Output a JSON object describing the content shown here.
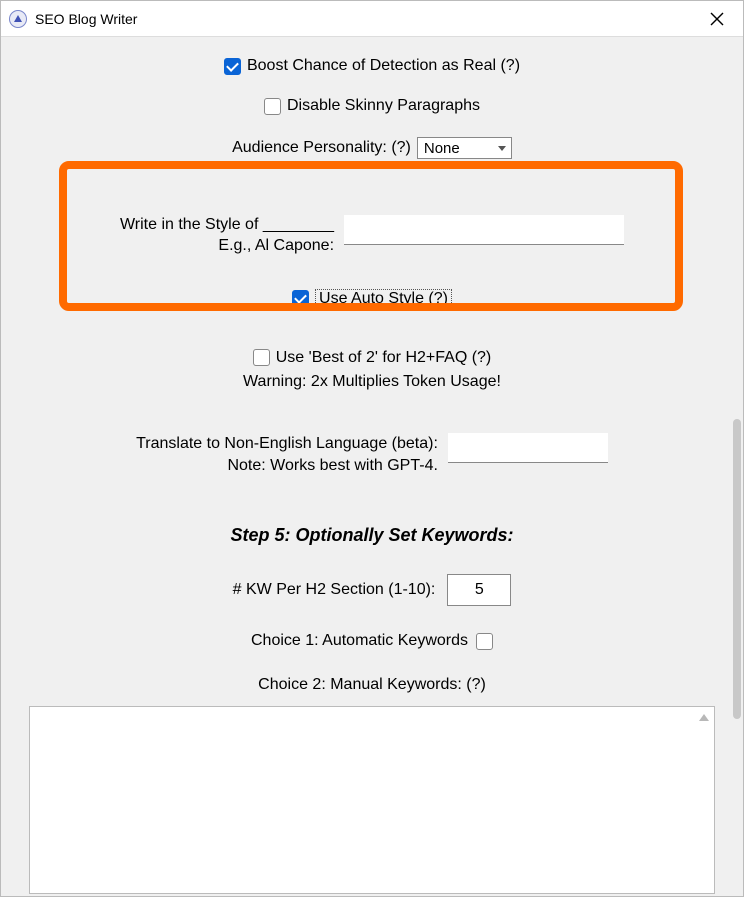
{
  "window": {
    "title": "SEO Blog Writer"
  },
  "boost_detection": {
    "label": "Boost Chance of Detection as Real (?)",
    "checked": true
  },
  "disable_skinny": {
    "label": "Disable Skinny Paragraphs",
    "checked": false
  },
  "audience": {
    "label": "Audience Personality: (?)",
    "selected": "None"
  },
  "style": {
    "label_line1": "Write in the Style of ________",
    "label_line2": "E.g., Al Capone:",
    "value": ""
  },
  "auto_style": {
    "label": "Use Auto Style (?)",
    "checked": true
  },
  "best_of_2": {
    "label": "Use 'Best of 2' for H2+FAQ (?)",
    "checked": false,
    "warning": "Warning: 2x Multiplies Token Usage!"
  },
  "translate": {
    "label_line1": "Translate to Non-English Language (beta):",
    "label_line2": "Note: Works best with GPT-4.",
    "value": ""
  },
  "step5": {
    "heading": "Step 5: Optionally Set Keywords:",
    "kw_per_h2_label": "# KW Per H2 Section (1-10):",
    "kw_per_h2_value": "5",
    "choice1_label": "Choice 1: Automatic Keywords",
    "choice1_checked": false,
    "choice2_label": "Choice 2: Manual Keywords: (?)",
    "manual_value": ""
  }
}
